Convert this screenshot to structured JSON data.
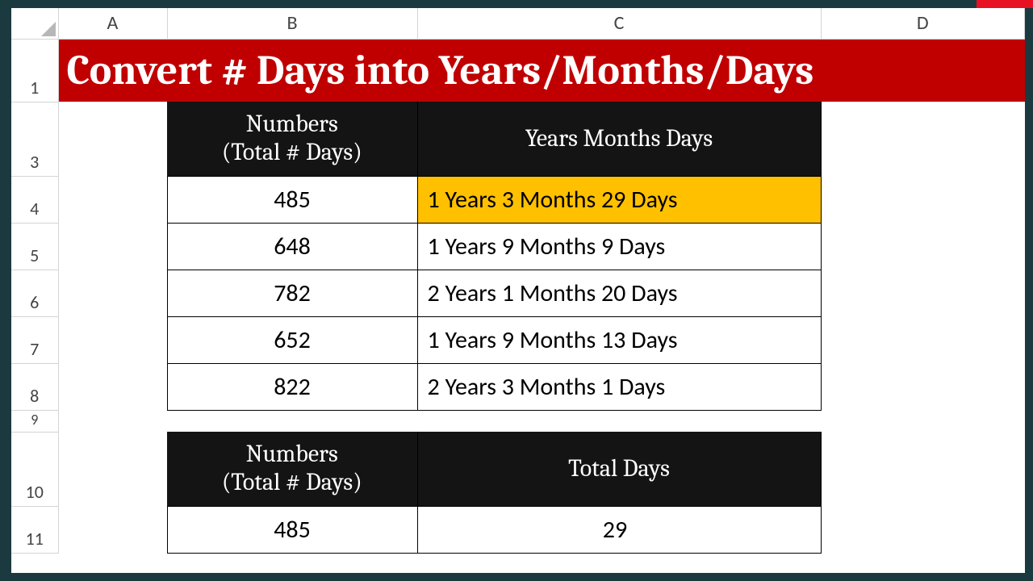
{
  "columns": {
    "A": "A",
    "B": "B",
    "C": "C",
    "D": "D"
  },
  "row_labels": [
    "1",
    "3",
    "4",
    "5",
    "6",
    "7",
    "8",
    "9",
    "10",
    "11"
  ],
  "title": "Convert # Days into Years/Months/Days",
  "table1": {
    "header_b": "Numbers\n(Total # Days)",
    "header_c": "Years Months Days",
    "rows": [
      {
        "num": "485",
        "text": "1 Years 3 Months 29 Days",
        "highlight": true
      },
      {
        "num": "648",
        "text": "1 Years 9 Months 9 Days",
        "highlight": false
      },
      {
        "num": "782",
        "text": "2 Years 1 Months 20 Days",
        "highlight": false
      },
      {
        "num": "652",
        "text": "1 Years 9 Months 13 Days",
        "highlight": false
      },
      {
        "num": "822",
        "text": "2 Years 3 Months 1 Days",
        "highlight": false
      }
    ]
  },
  "table2": {
    "header_b": "Numbers\n(Total # Days)",
    "header_c": "Total Days",
    "rows": [
      {
        "num": "485",
        "text": "29"
      }
    ]
  }
}
